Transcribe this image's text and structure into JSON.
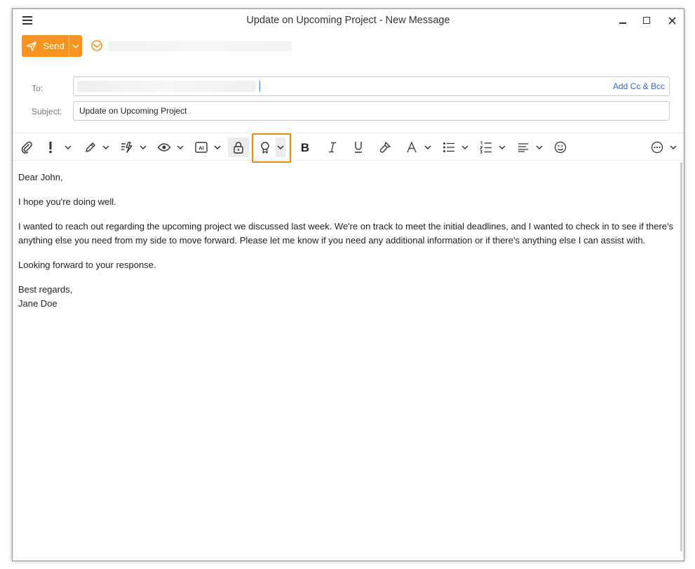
{
  "window": {
    "title": "Update on Upcoming Project - New Message",
    "accent_color": "#f7941d",
    "highlight_color": "#f28a00"
  },
  "send": {
    "label": "Send"
  },
  "compose": {
    "to_label": "To:",
    "add_cc_bcc": "Add Cc & Bcc",
    "subject_label": "Subject:",
    "subject_value": "Update on Upcoming Project"
  },
  "toolbar": {
    "items": [
      "attach-icon",
      "importance-icon",
      "sign-icon",
      "templates-icon",
      "read-receipt-icon",
      "ai-icon",
      "encrypt-lock-icon",
      "badge-icon",
      "bold-icon",
      "italic-icon",
      "underline-icon",
      "format-painter-icon",
      "font-color-icon",
      "bullet-list-icon",
      "numbered-list-icon",
      "align-icon",
      "emoji-icon",
      "more-icon"
    ]
  },
  "message": {
    "greeting": "Dear John,",
    "line1": "I hope you're doing well.",
    "paragraph": "I wanted to reach out regarding the upcoming project we discussed last week. We're on track to meet the initial deadlines, and I wanted to check in to see if there's anything else you need from my side to move forward. Please let me know if you need any additional information or if there's anything else I can assist with.",
    "closing_line": "Looking forward to your response.",
    "sign_off": "Best regards,",
    "signature": "Jane Doe"
  }
}
